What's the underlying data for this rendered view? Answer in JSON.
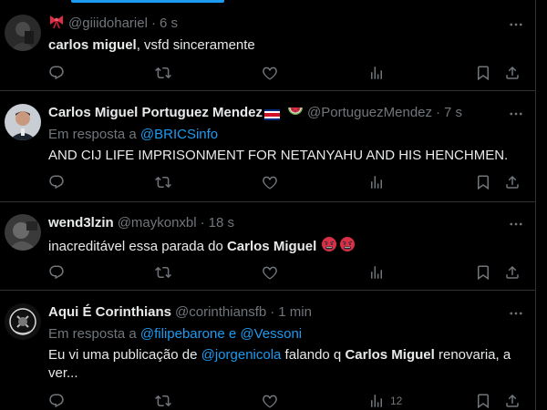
{
  "tweets": [
    {
      "name": "",
      "name_emoji": "bow-emoji",
      "handle": "@giiidohariel",
      "time": "6 s",
      "reply_prefix": "",
      "reply_to": "",
      "text_bold": "carlos miguel",
      "text_rest": ", vsfd sinceramente",
      "views": ""
    },
    {
      "name": "Carlos Miguel Portuguez Mendez",
      "name_emoji": "costa-rica-flag-and-watermelon",
      "handle": "@PortuguezMendez",
      "time": "7 s",
      "reply_prefix": "Em resposta a ",
      "reply_to": "@BRICSinfo",
      "text": "AND CIJ LIFE IMPRISONMENT FOR NETANYAHU AND HIS HENCHMEN.",
      "views": ""
    },
    {
      "name": "wend3lzin",
      "handle": "@maykonxbl",
      "time": "18 s",
      "text_plain": "inacreditável essa parada do ",
      "text_bold": "Carlos Miguel",
      "text_emoji": "angry-face-emojis",
      "views": ""
    },
    {
      "name": "Aqui É Corinthians",
      "handle": "@corinthiansfb",
      "time": "1 min",
      "reply_prefix": "Em resposta a ",
      "reply_to_1": "@filipebarone",
      "reply_and": " e ",
      "reply_to_2": "@Vessoni",
      "text_1": "Eu vi uma publicação de ",
      "text_link": "@jorgenicola",
      "text_2": " falando q ",
      "text_bold": "Carlos Miguel",
      "text_3": " renovaria, a ver...",
      "views": "12"
    }
  ],
  "separator": "·",
  "colors": {
    "accent": "#1d9bf0",
    "muted": "#71767b",
    "text": "#e7e9ea",
    "border": "#2f3336"
  }
}
